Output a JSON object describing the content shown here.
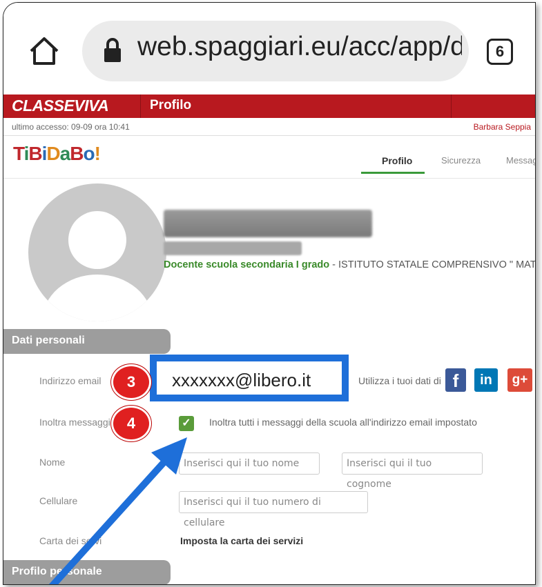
{
  "browser": {
    "url": "web.spaggiari.eu/acc/app/d",
    "tab_count": "6"
  },
  "header": {
    "app_logo": "CLASSEVIVA",
    "title": "Profilo",
    "last_access": "ultimo accesso: 09-09 ora 10:41",
    "user_name": "Barbara Seppia"
  },
  "nav": {
    "logo": "TiBiDaBo!",
    "tabs": [
      {
        "label": "Profilo",
        "active": true
      },
      {
        "label": "Sicurezza",
        "active": false
      },
      {
        "label": "Messaggi",
        "active": false
      }
    ]
  },
  "profile": {
    "role": "Docente scuola secondaria I grado",
    "school": " - ISTITUTO STATALE COMPRENSIVO \" MATTEO NUTI \" - FAN"
  },
  "sections": {
    "personal": "Dati personali",
    "profile": "Profilo personale"
  },
  "fields": {
    "email_label": "Indirizzo email",
    "email_value": "xxxxxxx@libero.it",
    "social_hint": "Utilizza i tuoi dati di",
    "forward_label": "Inoltra messaggi",
    "forward_text": "Inoltra tutti i messaggi della scuola all'indirizzo email impostato",
    "forward_checked": true,
    "name_label": "Nome",
    "name_placeholder": "Inserisci qui il tuo nome",
    "surname_placeholder": "Inserisci qui il tuo cognome",
    "phone_label": "Cellulare",
    "phone_placeholder": "Inserisci qui il tuo numero di cellulare",
    "services_label": "Carta dei servi",
    "services_link": "Imposta la carta dei servizi"
  },
  "annotations": {
    "badge_email": "3",
    "badge_forward": "4"
  },
  "colors": {
    "header_red": "#b8191f",
    "accent_green": "#3a9a3a",
    "highlight_blue": "#1e6fd9",
    "badge_red": "#e02020"
  }
}
